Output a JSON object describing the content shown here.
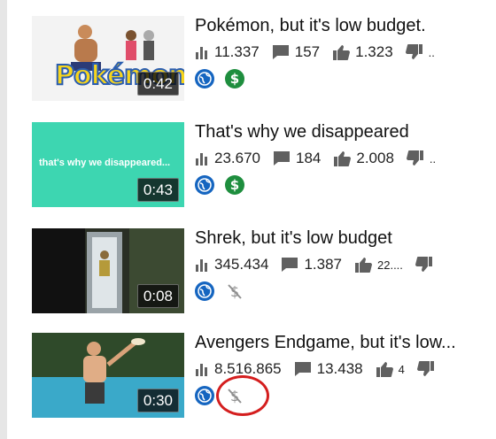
{
  "videos": [
    {
      "title": "Pokémon, but it's low budget.",
      "duration": "0:42",
      "views": "11.337",
      "comments": "157",
      "likes": "1.323",
      "dislikes": "..",
      "monetization": "monetized",
      "thumb_text": "Pokémon",
      "thumb_bg": "#f3f3f3"
    },
    {
      "title": "That's why we disappeared",
      "duration": "0:43",
      "views": "23.670",
      "comments": "184",
      "likes": "2.008",
      "dislikes": "..",
      "monetization": "monetized",
      "thumb_text": "that's why we disappeared...",
      "thumb_bg": "#3dd6b1"
    },
    {
      "title": "Shrek, but it's low budget",
      "duration": "0:08",
      "views": "345.434",
      "comments": "1.387",
      "likes": "22....",
      "dislikes": "",
      "monetization": "not-monetized",
      "thumb_text": "",
      "thumb_bg": "#1c1c1c"
    },
    {
      "title": "Avengers Endgame, but it's low...",
      "duration": "0:30",
      "views": "8.516.865",
      "comments": "13.438",
      "likes": "4",
      "dislikes": "",
      "monetization": "not-monetized",
      "thumb_text": "",
      "thumb_bg": "#4a6a5a"
    }
  ],
  "icons": {
    "views": "bar-chart-icon",
    "comments": "comment-icon",
    "likes": "thumbs-up-icon",
    "dislikes": "thumbs-down-icon",
    "visibility": "globe-icon",
    "monetized": "dollar-icon",
    "not_monetized": "dollar-off-icon"
  },
  "colors": {
    "visibility_blue": "#1565c0",
    "monetized_green": "#1e8e3e",
    "icon_gray": "#606060",
    "annotation_red": "#d41e1e"
  }
}
